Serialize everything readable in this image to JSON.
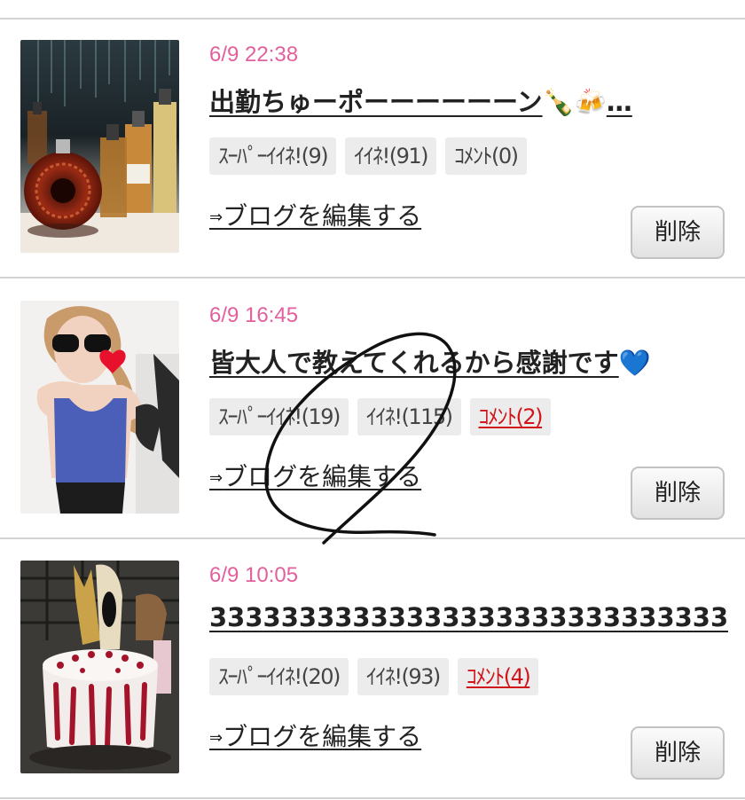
{
  "entries": [
    {
      "date": "6/9 22:38",
      "title": "出勤ちゅーポーーーーーーン",
      "title_suffix": "…",
      "emoji": [
        "🍾",
        "🍻"
      ],
      "tags": {
        "super_like": "ｽｰﾊﾟｰｲｲﾈ!(9)",
        "like": "ｲｲﾈ!(91)",
        "comment": "ｺﾒﾝﾄ(0)"
      },
      "comment_link": false,
      "edit_arrow": "⇒",
      "edit_label": "ブログを編集する",
      "delete_label": "削除",
      "thumb_icon": "liquor-bottles-photo"
    },
    {
      "date": "6/9 16:45",
      "title": "皆大人で教えてくれるから感謝です",
      "title_suffix": "",
      "emoji": [
        "💙"
      ],
      "tags": {
        "super_like": "ｽｰﾊﾟｰｲｲﾈ!(19)",
        "like": "ｲｲﾈ!(115)",
        "comment": "ｺﾒﾝﾄ(2)"
      },
      "comment_link": true,
      "edit_arrow": "⇒",
      "edit_label": "ブログを編集する",
      "delete_label": "削除",
      "thumb_icon": "woman-selfie-photo"
    },
    {
      "date": "6/9 10:05",
      "title": "333333333333333333333333333333",
      "title_suffix": "…",
      "emoji": [],
      "tags": {
        "super_like": "ｽｰﾊﾟｰｲｲﾈ!(20)",
        "like": "ｲｲﾈ!(93)",
        "comment": "ｺﾒﾝﾄ(4)"
      },
      "comment_link": true,
      "edit_arrow": "⇒",
      "edit_label": "ブログを編集する",
      "delete_label": "削除",
      "thumb_icon": "birthday-cake-photo"
    }
  ],
  "colors": {
    "date": "#e3609c",
    "comment_link": "#d0151b",
    "tag_bg": "#ececec",
    "divider": "#d2d2d2",
    "scribble": "#111111"
  }
}
